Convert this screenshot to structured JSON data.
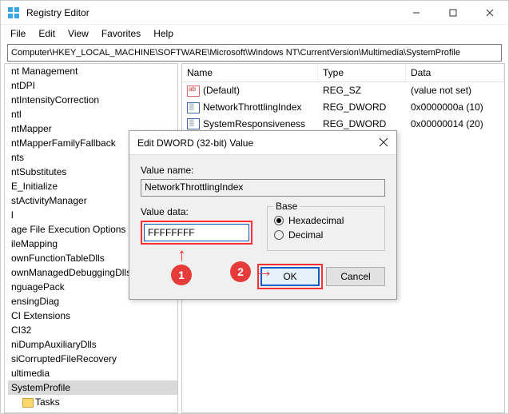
{
  "titlebar": {
    "title": "Registry Editor"
  },
  "menu": {
    "file": "File",
    "edit": "Edit",
    "view": "View",
    "favorites": "Favorites",
    "help": "Help"
  },
  "address": "Computer\\HKEY_LOCAL_MACHINE\\SOFTWARE\\Microsoft\\Windows NT\\CurrentVersion\\Multimedia\\SystemProfile",
  "tree": {
    "items": [
      "nt Management",
      "ntDPI",
      "ntIntensityCorrection",
      "ntl",
      "ntMapper",
      "ntMapperFamilyFallback",
      "nts",
      "ntSubstitutes",
      "E_Initialize",
      "stActivityManager",
      "l",
      "age File Execution Options",
      "ileMapping",
      "ownFunctionTableDlls",
      "ownManagedDebuggingDlls",
      "nguagePack",
      "ensingDiag",
      "CI Extensions",
      "CI32",
      "niDumpAuxiliaryDlls",
      "siCorruptedFileRecovery",
      "ultimedia"
    ],
    "selected": "SystemProfile",
    "child": "Tasks"
  },
  "list": {
    "headers": {
      "name": "Name",
      "type": "Type",
      "data": "Data"
    },
    "rows": [
      {
        "icon": "str",
        "name": "(Default)",
        "type": "REG_SZ",
        "data": "(value not set)"
      },
      {
        "icon": "dw",
        "name": "NetworkThrottlingIndex",
        "type": "REG_DWORD",
        "data": "0x0000000a (10)"
      },
      {
        "icon": "dw",
        "name": "SystemResponsiveness",
        "type": "REG_DWORD",
        "data": "0x00000014 (20)"
      }
    ]
  },
  "dialog": {
    "title": "Edit DWORD (32-bit) Value",
    "vn_label": "Value name:",
    "vn_value": "NetworkThrottlingIndex",
    "vd_label": "Value data:",
    "vd_value": "FFFFFFFF",
    "base_label": "Base",
    "hex_label": "Hexadecimal",
    "dec_label": "Decimal",
    "ok": "OK",
    "cancel": "Cancel"
  },
  "annotations": {
    "one": "1",
    "two": "2"
  }
}
